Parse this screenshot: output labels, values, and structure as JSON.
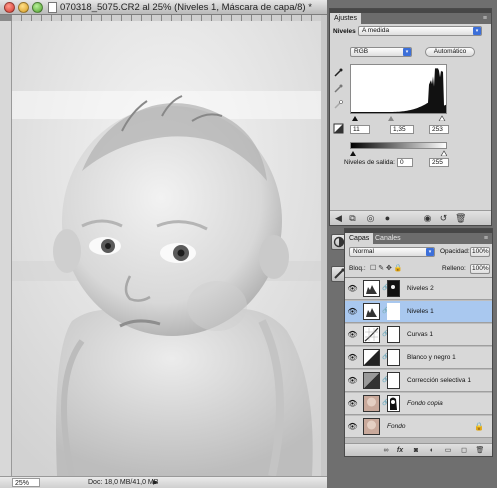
{
  "document": {
    "title": "070318_5075.CR2 al 25% (Niveles 1, Máscara de capa/8) *",
    "zoom": "25%",
    "doc_size": "Doc: 18,0 MB/41,0 MB",
    "status_arrow": "▶"
  },
  "adjustments": {
    "tab": "Ajustes",
    "menu": "≡",
    "panel_label": "Niveles",
    "preset": "A medida",
    "channel": "RGB",
    "auto_button": "Automático",
    "input_black": "11",
    "input_gamma": "1,35",
    "input_white": "253",
    "output_label": "Niveles de salida:",
    "output_black": "0",
    "output_white": "255",
    "histogram_peak_fraction": 0.93
  },
  "layers": {
    "tab_layers": "Capas",
    "tab_channels": "Canales",
    "menu": "≡",
    "blend_mode": "Normal",
    "opacity_label": "Opacidad:",
    "opacity_value": "100%",
    "lock_label": "Bloq.:",
    "fill_label": "Relleno:",
    "fill_value": "100%",
    "items": [
      {
        "name": "Niveles 2",
        "selected": false,
        "italic": false
      },
      {
        "name": "Niveles 1",
        "selected": true,
        "italic": false
      },
      {
        "name": "Curvas 1",
        "selected": false,
        "italic": false
      },
      {
        "name": "Blanco y negro 1",
        "selected": false,
        "italic": false
      },
      {
        "name": "Corrección selectiva 1",
        "selected": false,
        "italic": false
      },
      {
        "name": "Fondo copia",
        "selected": false,
        "italic": true
      },
      {
        "name": "Fondo",
        "selected": false,
        "italic": true
      }
    ]
  },
  "icons": {
    "eye": "eye-icon",
    "lock": "lock-icon",
    "chain": "chain-link-icon"
  },
  "colors": {
    "selection": "#a9c8ef",
    "accent": "#3c6fd9",
    "panel_bg": "#d6d6d6"
  }
}
